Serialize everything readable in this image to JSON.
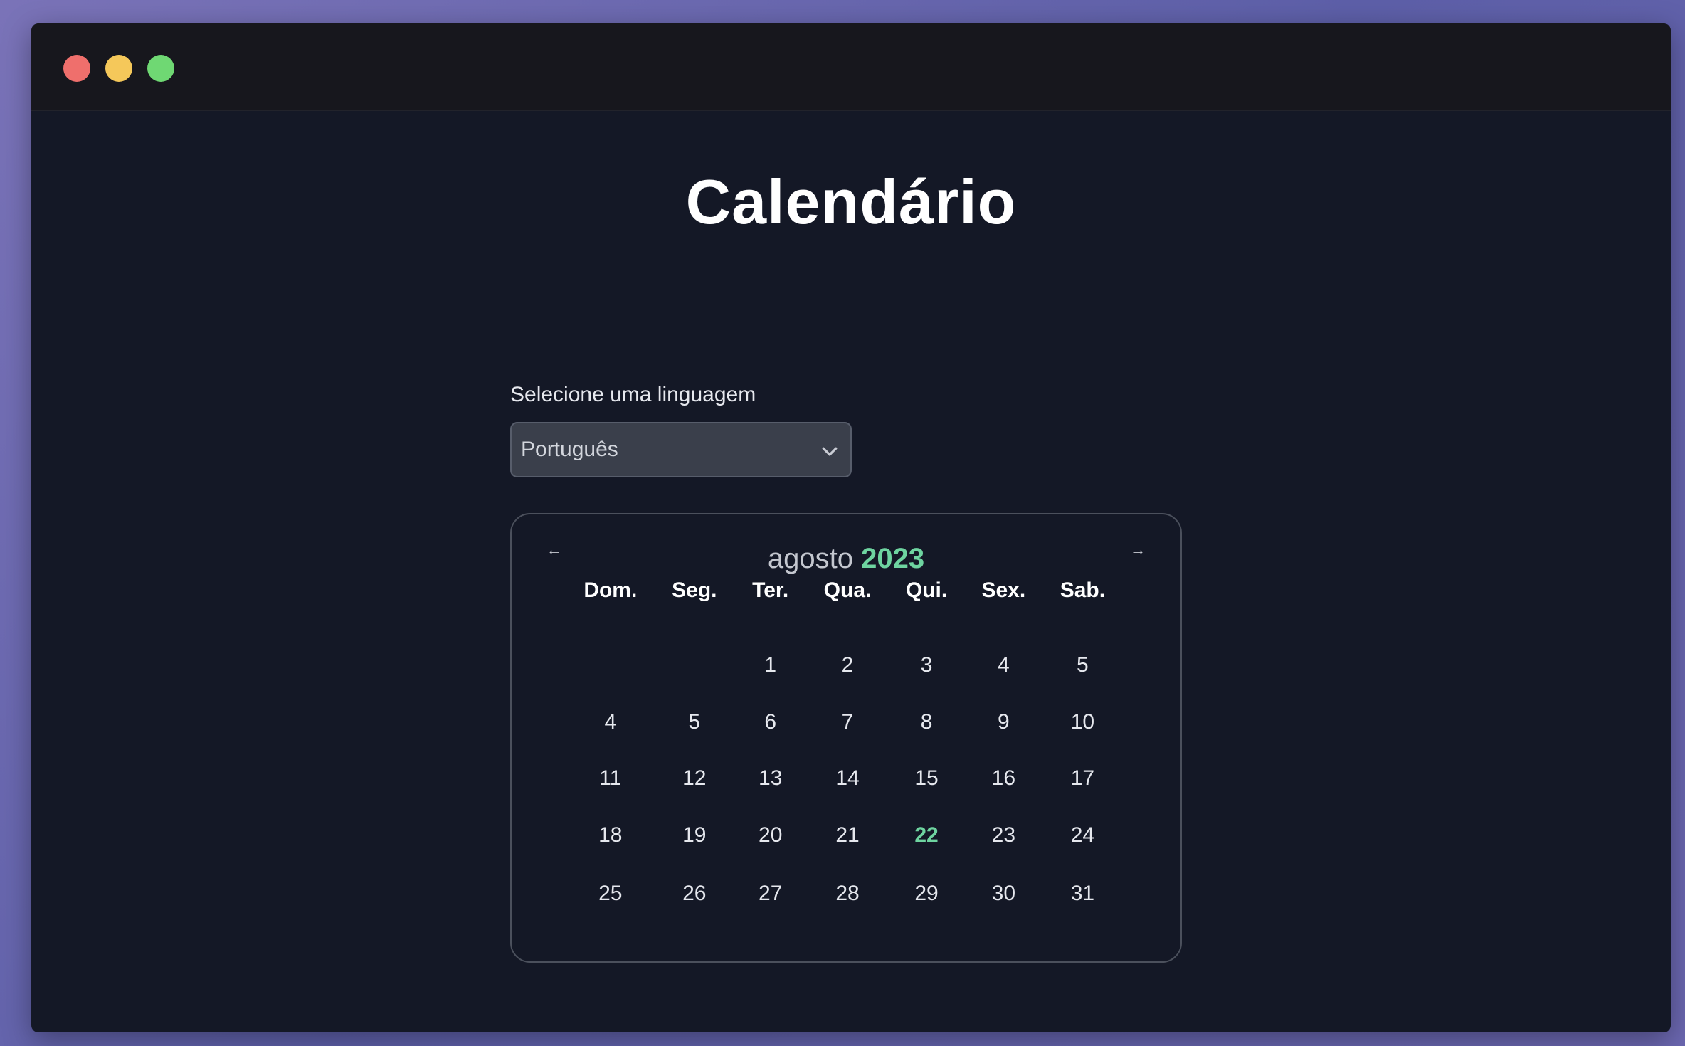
{
  "window": {
    "controls": [
      "close",
      "minimize",
      "maximize"
    ]
  },
  "page": {
    "title": "Calendário"
  },
  "language": {
    "label": "Selecione uma linguagem",
    "selected": "Português"
  },
  "calendar": {
    "prev_icon": "←",
    "next_icon": "→",
    "month": "agosto",
    "year": "2023",
    "weekdays": [
      "Dom.",
      "Seg.",
      "Ter.",
      "Qua.",
      "Qui.",
      "Sex.",
      "Sab."
    ],
    "weeks": [
      [
        "",
        "",
        "1",
        "2",
        "3",
        "4",
        "5"
      ],
      [
        "4",
        "5",
        "6",
        "7",
        "8",
        "9",
        "10"
      ],
      [
        "11",
        "12",
        "13",
        "14",
        "15",
        "16",
        "17"
      ],
      [
        "18",
        "19",
        "20",
        "21",
        "22",
        "23",
        "24"
      ],
      [
        "25",
        "26",
        "27",
        "28",
        "29",
        "30",
        "31"
      ]
    ],
    "highlighted_day": "22",
    "accent_color": "#6ed4a0"
  }
}
